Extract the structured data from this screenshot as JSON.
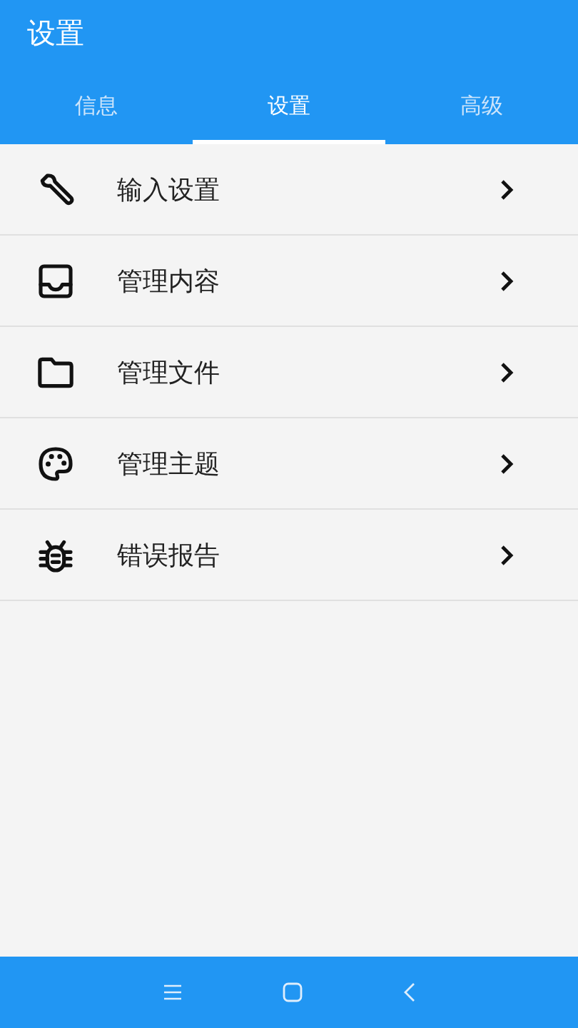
{
  "app_bar": {
    "title": "设置"
  },
  "tabs": [
    {
      "label": "信息",
      "selected": false
    },
    {
      "label": "设置",
      "selected": true
    },
    {
      "label": "高级",
      "selected": false
    }
  ],
  "items": [
    {
      "kind": "wrench",
      "label": "输入设置"
    },
    {
      "kind": "inbox",
      "label": "管理内容"
    },
    {
      "kind": "folder",
      "label": "管理文件"
    },
    {
      "kind": "palette",
      "label": "管理主题"
    },
    {
      "kind": "bug",
      "label": "错误报告"
    }
  ]
}
